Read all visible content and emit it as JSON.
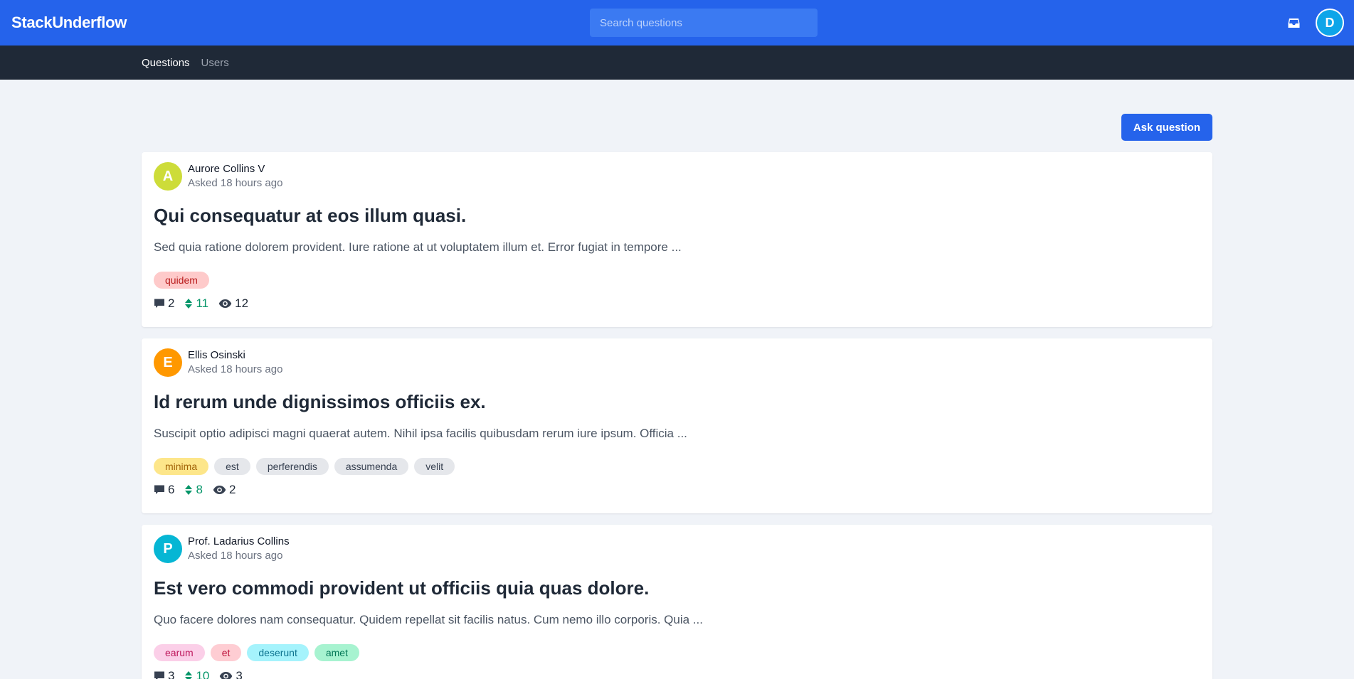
{
  "app": {
    "brand": "StackUnderflow",
    "search_placeholder": "Search questions",
    "user_initial": "D",
    "colors": {
      "primary": "#2563eb",
      "nav_dark": "#1f2937",
      "page_bg": "#f0f3f8"
    }
  },
  "nav": {
    "items": [
      {
        "label": "Questions",
        "active": true
      },
      {
        "label": "Users",
        "active": false
      }
    ]
  },
  "actions": {
    "ask_label": "Ask question"
  },
  "questions": [
    {
      "author": "Aurore Collins V",
      "initial": "A",
      "avatar_color": "#cddc39",
      "asked": "Asked 18 hours ago",
      "title": "Qui consequatur at eos illum quasi.",
      "excerpt": "Sed quia ratione dolorem provident. Iure ratione at ut voluptatem illum et. Error fugiat in tempore ...",
      "tags": [
        {
          "label": "quidem",
          "bg": "#fecaca",
          "fg": "#b91c1c"
        }
      ],
      "comments": "2",
      "votes": "11",
      "views": "12"
    },
    {
      "author": "Ellis Osinski",
      "initial": "E",
      "avatar_color": "#ff9800",
      "asked": "Asked 18 hours ago",
      "title": "Id rerum unde dignissimos officiis ex.",
      "excerpt": "Suscipit optio adipisci magni quaerat autem. Nihil ipsa facilis quibusdam rerum iure ipsum. Officia ...",
      "tags": [
        {
          "label": "minima",
          "bg": "#fde68a",
          "fg": "#a16207"
        },
        {
          "label": "est",
          "bg": "#e5e7eb",
          "fg": "#374151"
        },
        {
          "label": "perferendis",
          "bg": "#e5e7eb",
          "fg": "#374151"
        },
        {
          "label": "assumenda",
          "bg": "#e5e7eb",
          "fg": "#374151"
        },
        {
          "label": "velit",
          "bg": "#e5e7eb",
          "fg": "#374151"
        }
      ],
      "comments": "6",
      "votes": "8",
      "views": "2"
    },
    {
      "author": "Prof. Ladarius Collins",
      "initial": "P",
      "avatar_color": "#06b6d4",
      "asked": "Asked 18 hours ago",
      "title": "Est vero commodi provident ut officiis quia quas dolore.",
      "excerpt": "Quo facere dolores nam consequatur. Quidem repellat sit facilis natus. Cum nemo illo corporis. Quia ...",
      "tags": [
        {
          "label": "earum",
          "bg": "#fbcfe8",
          "fg": "#be185d"
        },
        {
          "label": "et",
          "bg": "#fecdd3",
          "fg": "#be123c"
        },
        {
          "label": "deserunt",
          "bg": "#a5f3fc",
          "fg": "#0e7490"
        },
        {
          "label": "amet",
          "bg": "#a7f3d0",
          "fg": "#047857"
        }
      ],
      "comments": "3",
      "votes": "10",
      "views": "3"
    }
  ]
}
